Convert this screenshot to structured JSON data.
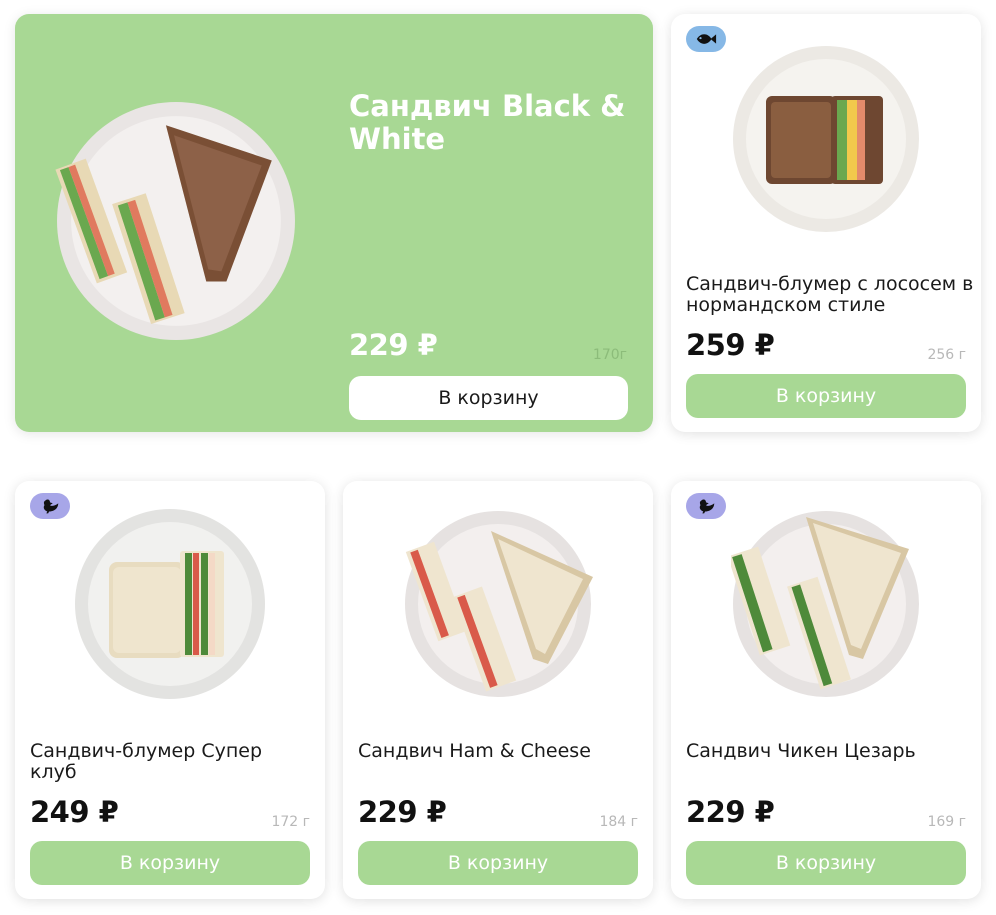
{
  "colors": {
    "accent_green": "#a8d894",
    "fish_badge": "#86b8e6",
    "chicken_badge": "#a7a6e8",
    "text_dark": "#1a1a1a",
    "weight_gray": "#b8b8b8"
  },
  "products": [
    {
      "name": "Сандвич Black & White",
      "price": "229 ₽",
      "weight": "170г",
      "button_label": "В корзину",
      "featured": true,
      "badge_icon": null
    },
    {
      "name": "Сандвич-блумер с лососем в нормандском стиле",
      "price": "259 ₽",
      "weight": "256 г",
      "button_label": "В корзину",
      "featured": false,
      "badge_icon": "fish-icon"
    },
    {
      "name": "Сандвич-блумер Супер клуб",
      "price": "249 ₽",
      "weight": "172 г",
      "button_label": "В корзину",
      "featured": false,
      "badge_icon": "chicken-icon"
    },
    {
      "name": "Сандвич Ham & Cheese",
      "price": "229 ₽",
      "weight": "184 г",
      "button_label": "В корзину",
      "featured": false,
      "badge_icon": null
    },
    {
      "name": "Сандвич Чикен Цезарь",
      "price": "229 ₽",
      "weight": "169 г",
      "button_label": "В корзину",
      "featured": false,
      "badge_icon": "chicken-icon"
    }
  ]
}
